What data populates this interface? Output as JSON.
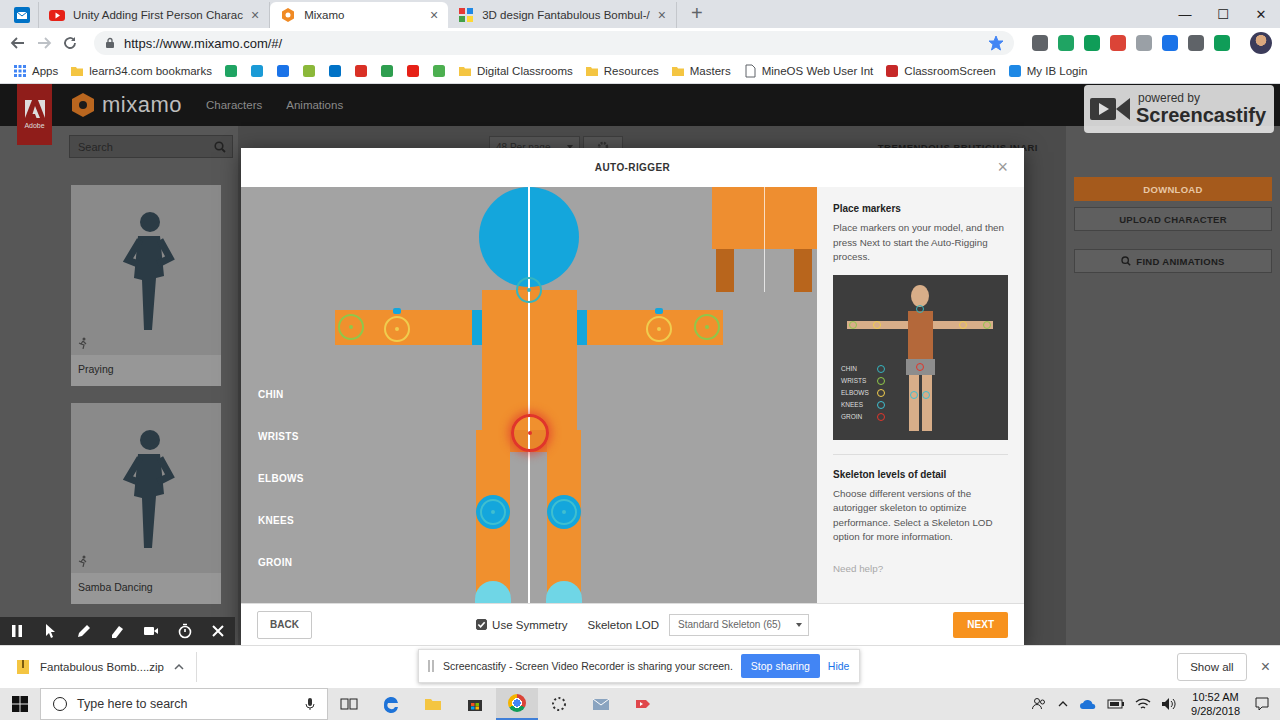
{
  "browser": {
    "tabs": [
      {
        "kind": "outlook",
        "pinned": true,
        "selected": false
      },
      {
        "title": "Unity Adding First Person Charac",
        "kind": "youtube",
        "pinned": false,
        "selected": false
      },
      {
        "title": "Mixamo",
        "kind": "mixamo",
        "pinned": false,
        "selected": true
      },
      {
        "title": "3D design Fantabulous Bombul-/",
        "kind": "tinkercad",
        "pinned": false,
        "selected": false
      }
    ],
    "tab_close": "×",
    "new_tab": "+",
    "window_controls": [
      "—",
      "☐",
      "✕"
    ],
    "url": "https://www.mixamo.com/#/",
    "bookmarked": true,
    "extensions": [
      {
        "color": "#5f6368"
      },
      {
        "color": "#1fa463"
      },
      {
        "color": "#0f9d58"
      },
      {
        "color": "#db4437"
      },
      {
        "color": "#9aa0a6"
      },
      {
        "color": "#1a73e8"
      },
      {
        "color": "#5f6368"
      },
      {
        "color": "#0f9d58"
      }
    ],
    "bookmarks": [
      {
        "label": "Apps",
        "kind": "apps",
        "color": "#4285f4"
      },
      {
        "label": "learn34.com bookmarks",
        "kind": "folder",
        "color": "#f4c542"
      },
      {
        "kind": "icon",
        "color": "#1fa463"
      },
      {
        "kind": "icon",
        "color": "#1a9ad6"
      },
      {
        "kind": "icon",
        "color": "#1a73e8"
      },
      {
        "kind": "icon",
        "color": "#8bb83a"
      },
      {
        "kind": "icon",
        "color": "#0072c6"
      },
      {
        "kind": "icon",
        "color": "#d93025"
      },
      {
        "kind": "icon",
        "color": "#2e9e4f"
      },
      {
        "kind": "icon",
        "color": "#e62117"
      },
      {
        "kind": "icon",
        "color": "#4caf50"
      },
      {
        "label": "Digital Classrooms",
        "kind": "folder",
        "color": "#f4c542"
      },
      {
        "label": "Resources",
        "kind": "folder",
        "color": "#f4c542"
      },
      {
        "label": "Masters",
        "kind": "folder",
        "color": "#f4c542"
      },
      {
        "label": "MineOS Web User Int",
        "kind": "page",
        "color": "#5f6368"
      },
      {
        "label": "ClassroomScreen",
        "kind": "icon",
        "color": "#c62828"
      },
      {
        "label": "My IB Login",
        "kind": "icon",
        "color": "#1e88e5"
      }
    ]
  },
  "mixamo": {
    "adobe": "Adobe",
    "brand": "mixamo",
    "nav": [
      {
        "label": "Characters"
      },
      {
        "label": "Animations"
      }
    ],
    "search": {
      "placeholder": "Search"
    },
    "cards": [
      {
        "label": "Praying"
      },
      {
        "label": "Samba Dancing"
      }
    ],
    "per_page": "48 Per page",
    "character": "TREMENDOUS BRUTICUS INARI",
    "actions": [
      {
        "label": "DOWNLOAD",
        "kind": "primary"
      },
      {
        "label": "UPLOAD CHARACTER",
        "kind": "secondary"
      },
      {
        "label": "FIND ANIMATIONS",
        "kind": "search"
      }
    ]
  },
  "watermark": {
    "small": "powered by",
    "brand": "Screencastify"
  },
  "auto_rigger": {
    "title": "AUTO-RIGGER",
    "close": "×",
    "markers": [
      {
        "label": "CHIN",
        "color": "#35b5c0",
        "selected": false
      },
      {
        "label": "WRISTS",
        "color": "#8fc74a",
        "selected": false
      },
      {
        "label": "ELBOWS",
        "color": "#f0cc4e",
        "selected": false
      },
      {
        "label": "KNEES",
        "color": "#3fbfd0",
        "selected": false
      },
      {
        "label": "GROIN",
        "color": "#e0352b",
        "selected": true
      }
    ],
    "instructions": {
      "heading": "Place markers",
      "body": "Place markers on your model, and then press Next to start the Auto-Rigging process."
    },
    "lod_info": {
      "heading": "Skeleton levels of detail",
      "body": "Choose different versions of the autorigger skeleton to optimize performance. Select a Skeleton LOD option for more information."
    },
    "help": "Need help?",
    "back": "BACK",
    "symmetry": {
      "label": "Use Symmetry",
      "checked": true
    },
    "lod": {
      "label": "Skeleton LOD",
      "value": "Standard Skeleton (65)"
    },
    "next": "NEXT"
  },
  "recorder_tools": [
    {
      "kind": "pause"
    },
    {
      "kind": "cursor"
    },
    {
      "kind": "pen"
    },
    {
      "kind": "highlighter"
    },
    {
      "kind": "camera"
    },
    {
      "kind": "timer"
    },
    {
      "kind": "close"
    }
  ],
  "downloads": {
    "file": "Fantabulous Bomb....zip",
    "show_all": "Show all",
    "close": "×"
  },
  "share_notice": {
    "text": "Screencastify - Screen Video Recorder is sharing your screen.",
    "stop": "Stop sharing",
    "hide": "Hide"
  },
  "taskbar": {
    "search": {
      "placeholder": "Type here to search"
    },
    "apps": [
      {
        "kind": "taskview",
        "selected": false
      },
      {
        "kind": "edge",
        "selected": false
      },
      {
        "kind": "explorer",
        "selected": false
      },
      {
        "kind": "store",
        "selected": false
      },
      {
        "kind": "chrome",
        "selected": true
      },
      {
        "kind": "spinner",
        "selected": false
      },
      {
        "kind": "mail",
        "selected": false
      },
      {
        "kind": "screencastify",
        "selected": false
      }
    ],
    "time": "10:52 AM",
    "date": "9/28/2018"
  }
}
